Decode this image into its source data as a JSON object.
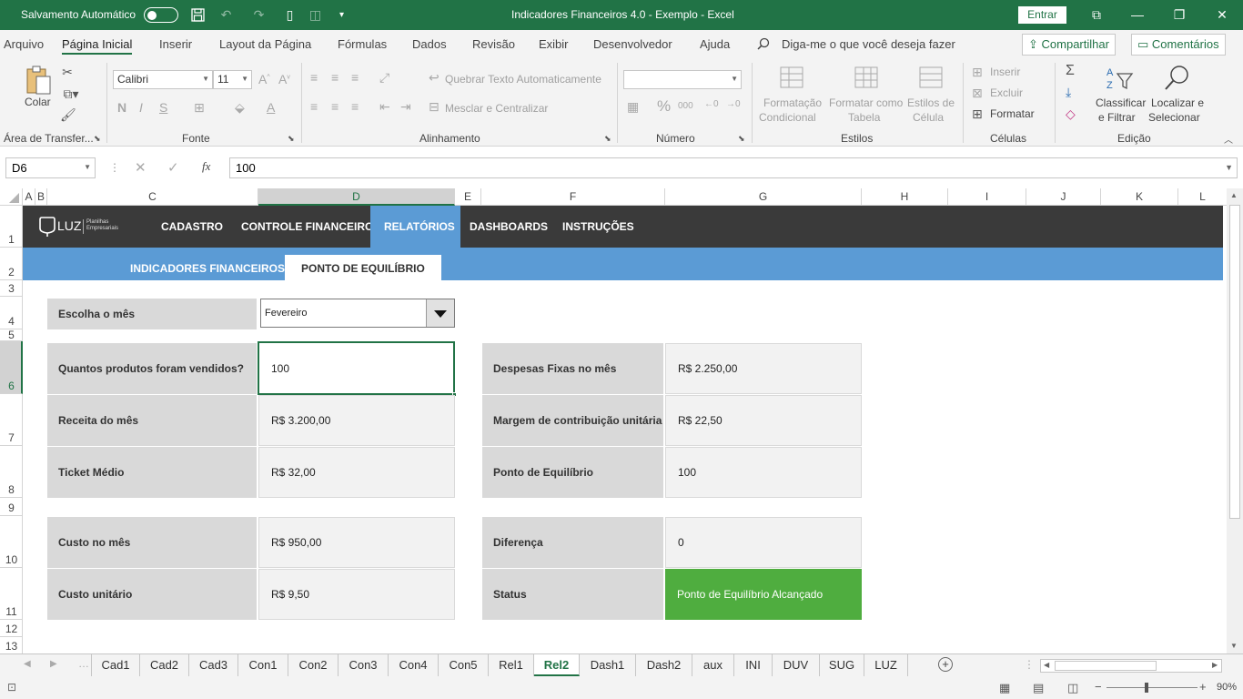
{
  "titlebar": {
    "autosave": "Salvamento Automático",
    "title": "Indicadores Financeiros 4.0 - Exemplo  -  Excel",
    "signin": "Entrar"
  },
  "tabs": [
    "Arquivo",
    "Página Inicial",
    "Inserir",
    "Layout da Página",
    "Fórmulas",
    "Dados",
    "Revisão",
    "Exibir",
    "Desenvolvedor",
    "Ajuda"
  ],
  "tell_me": "Diga-me o que você deseja fazer",
  "share": "Compartilhar",
  "comments": "Comentários",
  "ribbon": {
    "paste": "Colar",
    "clipboard": "Área de Transfer...",
    "font_name": "Calibri",
    "font_size": "11",
    "font_group": "Fonte",
    "wrap_text": "Quebrar Texto Automaticamente",
    "merge": "Mesclar e Centralizar",
    "align_group": "Alinhamento",
    "number_group": "Número",
    "cond_format_1": "Formatação",
    "cond_format_2": "Condicional",
    "format_table_1": "Formatar como",
    "format_table_2": "Tabela",
    "cell_styles_1": "Estilos de",
    "cell_styles_2": "Célula",
    "styles_group": "Estilos",
    "insert": "Inserir",
    "delete": "Excluir",
    "format": "Formatar",
    "cells_group": "Células",
    "sort_1": "Classificar",
    "sort_2": "e Filtrar",
    "find_1": "Localizar e",
    "find_2": "Selecionar",
    "editing_group": "Edição"
  },
  "formula_bar": {
    "name_box": "D6",
    "fx": "fx",
    "value": "100"
  },
  "columns": [
    "A",
    "B",
    "C",
    "D",
    "E",
    "F",
    "G",
    "H",
    "I",
    "J",
    "K",
    "L"
  ],
  "rows": [
    "1",
    "2",
    "3",
    "4",
    "5",
    "6",
    "7",
    "8",
    "9",
    "10",
    "11",
    "12",
    "13"
  ],
  "sheet": {
    "logo": "LUZ",
    "logo_sub_1": "Planilhas",
    "logo_sub_2": "Empresariais",
    "nav": [
      "CADASTRO",
      "CONTROLE FINANCEIRO",
      "RELATÓRIOS",
      "DASHBOARDS",
      "INSTRUÇÕES"
    ],
    "subnav": [
      "INDICADORES FINANCEIROS",
      "PONTO DE EQUILÍBRIO"
    ],
    "month_label": "Escolha o mês",
    "month_value": "Fevereiro",
    "left_block": [
      {
        "label": "Quantos produtos foram vendidos?",
        "value": "100"
      },
      {
        "label": "Receita do mês",
        "value": "R$ 3.200,00"
      },
      {
        "label": "Ticket Médio",
        "value": "R$ 32,00"
      }
    ],
    "left_block2": [
      {
        "label": "Custo no mês",
        "value": "R$ 950,00"
      },
      {
        "label": "Custo unitário",
        "value": "R$ 9,50"
      }
    ],
    "right_block": [
      {
        "label": "Despesas Fixas no mês",
        "value": "R$ 2.250,00"
      },
      {
        "label": "Margem de contribuição unitária",
        "value": "R$ 22,50"
      },
      {
        "label": "Ponto de Equilíbrio",
        "value": "100"
      }
    ],
    "right_block2": [
      {
        "label": "Diferença",
        "value": "0"
      },
      {
        "label": "Status",
        "value": "Ponto de Equilíbrio Alcançado"
      }
    ],
    "status_color": "#4fad3f",
    "header_color": "#3a3a3a",
    "accent_color": "#5b9bd5"
  },
  "sheet_tabs": [
    "Cad1",
    "Cad2",
    "Cad3",
    "Con1",
    "Con2",
    "Con3",
    "Con4",
    "Con5",
    "Rel1",
    "Rel2",
    "Dash1",
    "Dash2",
    "aux",
    "INI",
    "DUV",
    "SUG",
    "LUZ"
  ],
  "active_sheet": "Rel2",
  "zoom": "90%"
}
